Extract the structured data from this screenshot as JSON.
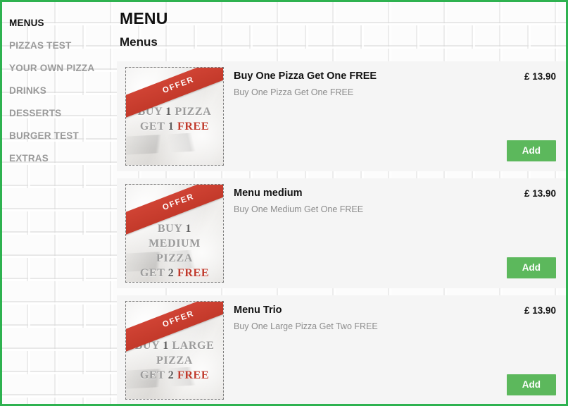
{
  "theme": {
    "frame_border_color": "#2eb250",
    "add_button_color": "#5cb85c",
    "ribbon_color": "#c3392a",
    "card_background": "#f5f5f5",
    "active_nav_color": "#121212",
    "inactive_nav_color": "#9a9a9a"
  },
  "sidebar": {
    "items": [
      {
        "label": "MENUS",
        "active": true
      },
      {
        "label": "PIZZAS TEST",
        "active": false
      },
      {
        "label": "YOUR OWN PIZZA",
        "active": false
      },
      {
        "label": "DRINKS",
        "active": false
      },
      {
        "label": "DESSERTS",
        "active": false
      },
      {
        "label": "BURGER TEST",
        "active": false
      },
      {
        "label": "EXTRAS",
        "active": false
      }
    ]
  },
  "header": {
    "page_title": "MENU",
    "section_title": "Menus"
  },
  "menu_items": [
    {
      "name": "Buy One Pizza Get One FREE",
      "description": "Buy One Pizza Get One FREE",
      "price": "£ 13.90",
      "add_label": "Add",
      "image": {
        "ribbon_label": "OFFER",
        "lines": [
          {
            "pre": "BUY ",
            "num": "1",
            "post": " PIZZA",
            "free": ""
          },
          {
            "pre": "GET ",
            "num": "1",
            "post": " ",
            "free": "FREE"
          }
        ]
      }
    },
    {
      "name": "Menu medium",
      "description": "Buy One Medium Get One FREE",
      "price": "£ 13.90",
      "add_label": "Add",
      "image": {
        "ribbon_label": "OFFER",
        "lines": [
          {
            "pre": "BUY ",
            "num": "1",
            "post": " MEDIUM",
            "free": ""
          },
          {
            "pre": "PIZZA",
            "num": "",
            "post": "",
            "free": ""
          },
          {
            "pre": "GET ",
            "num": "2",
            "post": " ",
            "free": "FREE"
          }
        ]
      }
    },
    {
      "name": "Menu Trio",
      "description": "Buy One Large Pizza Get Two FREE",
      "price": "£ 13.90",
      "add_label": "Add",
      "image": {
        "ribbon_label": "OFFER",
        "lines": [
          {
            "pre": "BUY ",
            "num": "1",
            "post": " LARGE",
            "free": ""
          },
          {
            "pre": "PIZZA",
            "num": "",
            "post": "",
            "free": ""
          },
          {
            "pre": "GET ",
            "num": "2",
            "post": " ",
            "free": "FREE"
          }
        ]
      }
    }
  ]
}
